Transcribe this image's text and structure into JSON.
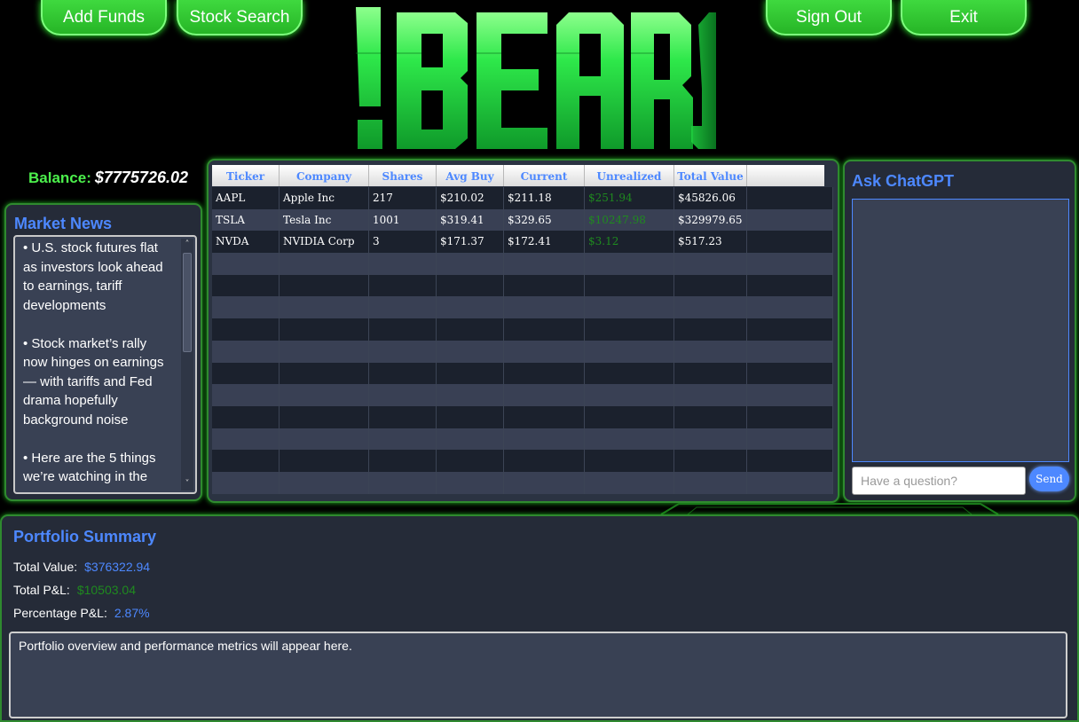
{
  "top_buttons": {
    "add_funds": "Add Funds",
    "stock_search": "Stock Search",
    "sign_out": "Sign Out",
    "exit": "Exit"
  },
  "logo": {
    "text": "!BEARS"
  },
  "balance": {
    "label": "Balance:",
    "value": "$7775726.02"
  },
  "news": {
    "title": "Market News",
    "items": [
      "• U.S. stock futures flat as investors look ahead to earnings, tariff developments",
      "• Stock market’s rally now hinges on earnings — with tariffs and Fed drama hopefully background noise",
      "• Here are the 5 things we’re watching in the"
    ]
  },
  "holdings": {
    "columns": [
      "Ticker",
      "Company",
      "Shares",
      "Avg Buy",
      "Current Price",
      "Unrealized Gain",
      "Total Value"
    ],
    "rows": [
      [
        "AAPL",
        "Apple Inc",
        "217",
        "$210.02",
        "$211.18",
        "$251.94",
        "$45826.06"
      ],
      [
        "TSLA",
        "Tesla Inc",
        "1001",
        "$319.41",
        "$329.65",
        "$10247.98",
        "$329979.65"
      ],
      [
        "NVDA",
        "NVIDIA Corp",
        "3",
        "$171.37",
        "$172.41",
        "$3.12",
        "$517.23"
      ]
    ]
  },
  "chat": {
    "title": "Ask ChatGPT",
    "input_placeholder": "Have a question?",
    "send_label": "Send"
  },
  "summary": {
    "title": "Portfolio Summary",
    "total_value_label": "Total Value:",
    "total_value": "$376322.94",
    "total_pl_label": "Total P&L:",
    "total_pl": "$10503.04",
    "pct_pl_label": "Percentage P&L:",
    "pct_pl": "2.87%",
    "overview_text": "Portfolio overview and performance metrics will appear here."
  },
  "colors": {
    "accent_green": "#3fd93f",
    "accent_blue": "#4d88ff",
    "gain_green": "#1f8a1f",
    "panel_bg": "#252b38"
  }
}
